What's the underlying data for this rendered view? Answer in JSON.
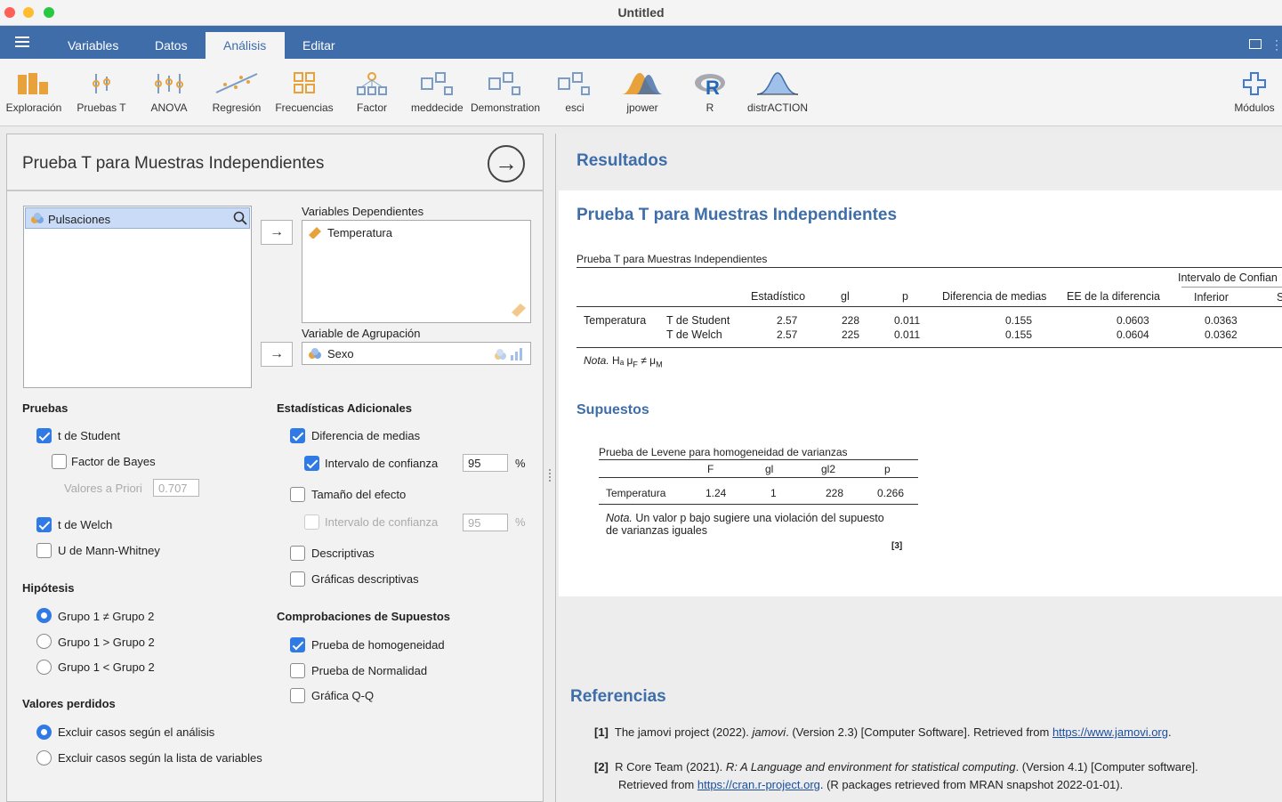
{
  "window": {
    "title": "Untitled",
    "traffic": {
      "close": "#fe5f57",
      "min": "#febc2e",
      "max": "#28c840"
    }
  },
  "menu": {
    "tabs": [
      "Variables",
      "Datos",
      "Análisis",
      "Editar"
    ],
    "active": "Análisis"
  },
  "toolbar": {
    "items": [
      "Exploración",
      "Pruebas T",
      "ANOVA",
      "Regresión",
      "Frecuencias",
      "Factor",
      "meddecide",
      "Demonstration",
      "esci",
      "jpower",
      "R",
      "distrACTION"
    ],
    "modules": "Módulos"
  },
  "left": {
    "title": "Prueba T para Muestras Independientes",
    "source_var": "Pulsaciones",
    "dep_label": "Variables Dependientes",
    "dep_var": "Temperatura",
    "group_label": "Variable de Agrupación",
    "group_var": "Sexo",
    "pruebas": {
      "head": "Pruebas",
      "student": "t de Student",
      "bayes": "Factor de Bayes",
      "priori_label": "Valores a Priori",
      "priori_value": "0.707",
      "welch": "t de Welch",
      "mann": "U de Mann-Whitney"
    },
    "hip": {
      "head": "Hipótesis",
      "h1": "Grupo 1 ≠ Grupo 2",
      "h2": "Grupo 1 > Grupo 2",
      "h3": "Grupo 1 < Grupo 2"
    },
    "perd": {
      "head": "Valores perdidos",
      "p1": "Excluir casos según el análisis",
      "p2": "Excluir casos según la lista de variables"
    },
    "adic": {
      "head": "Estadísticas Adicionales",
      "diff": "Diferencia de medias",
      "ci": "Intervalo de confianza",
      "ci_value": "95",
      "pct": "%",
      "eff": "Tamaño del efecto",
      "eff_ci": "Intervalo de confianza",
      "eff_ci_value": "95",
      "desc": "Descriptivas",
      "graf": "Gráficas descriptivas"
    },
    "sup": {
      "head": "Comprobaciones de Supuestos",
      "homo": "Prueba de homogeneidad",
      "norm": "Prueba de Normalidad",
      "qq": "Gráfica Q-Q"
    }
  },
  "results": {
    "head": "Resultados",
    "title": "Prueba T para Muestras Independientes",
    "table_title": "Prueba T para Muestras Independientes",
    "ci_header": "Intervalo de Confian",
    "cols": [
      "Estadístico",
      "gl",
      "p",
      "Diferencia de medias",
      "EE de la diferencia",
      "Inferior",
      "S"
    ],
    "var": "Temperatura",
    "rows": [
      [
        "T de Student",
        "2.57",
        "228",
        "0.011",
        "0.155",
        "0.0603",
        "0.0363"
      ],
      [
        "T de Welch",
        "2.57",
        "225",
        "0.011",
        "0.155",
        "0.0604",
        "0.0362"
      ]
    ],
    "nota_label": "Nota.",
    "nota_text": "Hₐ μ",
    "nota_sub1": "F",
    "nota_neq": " ≠ μ",
    "nota_sub2": "M",
    "sup_head": "Supuestos",
    "lev_title": "Prueba de Levene para homogeneidad de varianzas",
    "lev_cols": [
      "F",
      "gl",
      "gl2",
      "p"
    ],
    "lev_row": [
      "Temperatura",
      "1.24",
      "1",
      "228",
      "0.266"
    ],
    "lev_nota_label": "Nota.",
    "lev_nota_text": "Un valor p bajo sugiere una violación del supuesto",
    "lev_nota_text2": "de varianzas iguales",
    "lev_ref": "[3]"
  },
  "refs": {
    "head": "Referencias",
    "r1_num": "[1]",
    "r1_pre": "The jamovi project (2022). ",
    "r1_it": "jamovi",
    "r1_mid": ". (Version 2.3) [Computer Software]. Retrieved from ",
    "r1_link": "https://www.jamovi.org",
    "r1_end": ".",
    "r2_num": "[2]",
    "r2_pre": "R Core Team (2021). ",
    "r2_it": "R: A Language and environment for statistical computing",
    "r2_mid": ". (Version 4.1) [Computer software].",
    "r2_l2pre": "Retrieved from ",
    "r2_link": "https://cran.r-project.org",
    "r2_end": ". (R packages retrieved from MRAN snapshot 2022-01-01)."
  }
}
